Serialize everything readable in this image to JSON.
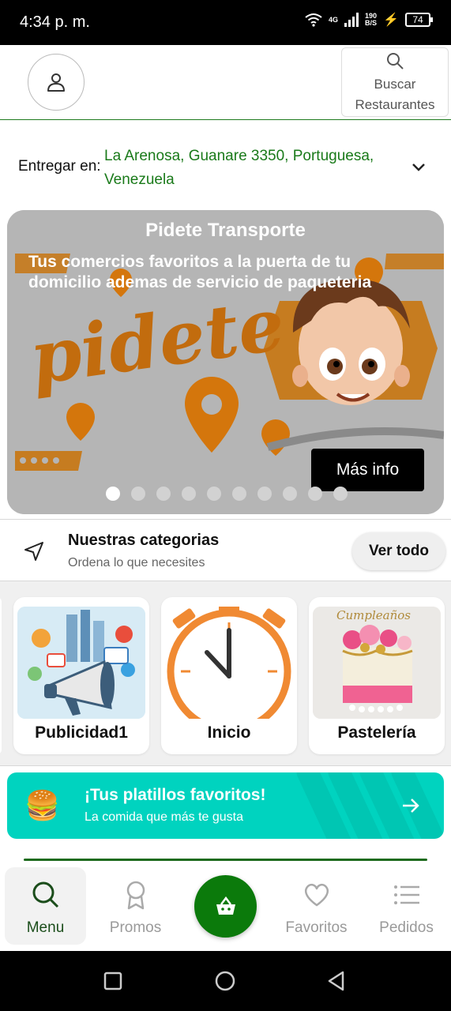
{
  "status_bar": {
    "time": "4:34 p. m.",
    "network": "4G",
    "speed_value": "190",
    "speed_unit": "B/S",
    "battery": "74"
  },
  "header": {
    "search_label_line1": "Buscar",
    "search_label_line2": "Restaurantes"
  },
  "deliver": {
    "label": "Entregar en:",
    "address": "La Arenosa, Guanare 3350, Portuguesa, Venezuela"
  },
  "banner": {
    "title": "Pidete Transporte",
    "subtitle": "Tus comercios favoritos a la puerta de tu domicilio ademas de servicio de paqueteria",
    "logo_text": "pidete",
    "more_button": "Más info",
    "slides_total": 10,
    "active_slide": 1
  },
  "categories": {
    "title": "Nuestras categorias",
    "subtitle": "Ordena lo que necesites",
    "view_all": "Ver todo",
    "items": [
      {
        "name": "Publicidad1",
        "icon": "megaphone-illustration"
      },
      {
        "name": "Inicio",
        "icon": "stopwatch-illustration"
      },
      {
        "name": "Pastelería",
        "icon": "birthday-cake-photo",
        "image_text": "Cumpleaños"
      }
    ]
  },
  "promo": {
    "title": "¡Tus platillos favoritos!",
    "subtitle": "La comida que más te gusta",
    "emoji": "🍔",
    "color": "#00d3bf"
  },
  "bottom_nav": {
    "items": [
      {
        "label": "Menu",
        "icon": "search-icon",
        "active": true
      },
      {
        "label": "Promos",
        "icon": "award-icon",
        "active": false
      },
      {
        "label": "Favoritos",
        "icon": "heart-icon",
        "active": false
      },
      {
        "label": "Pedidos",
        "icon": "list-icon",
        "active": false
      }
    ],
    "cart_icon": "basket-icon"
  },
  "colors": {
    "brand_green": "#0b7a0b",
    "address_green": "#1a7a1a",
    "promo_teal": "#00d3bf"
  }
}
